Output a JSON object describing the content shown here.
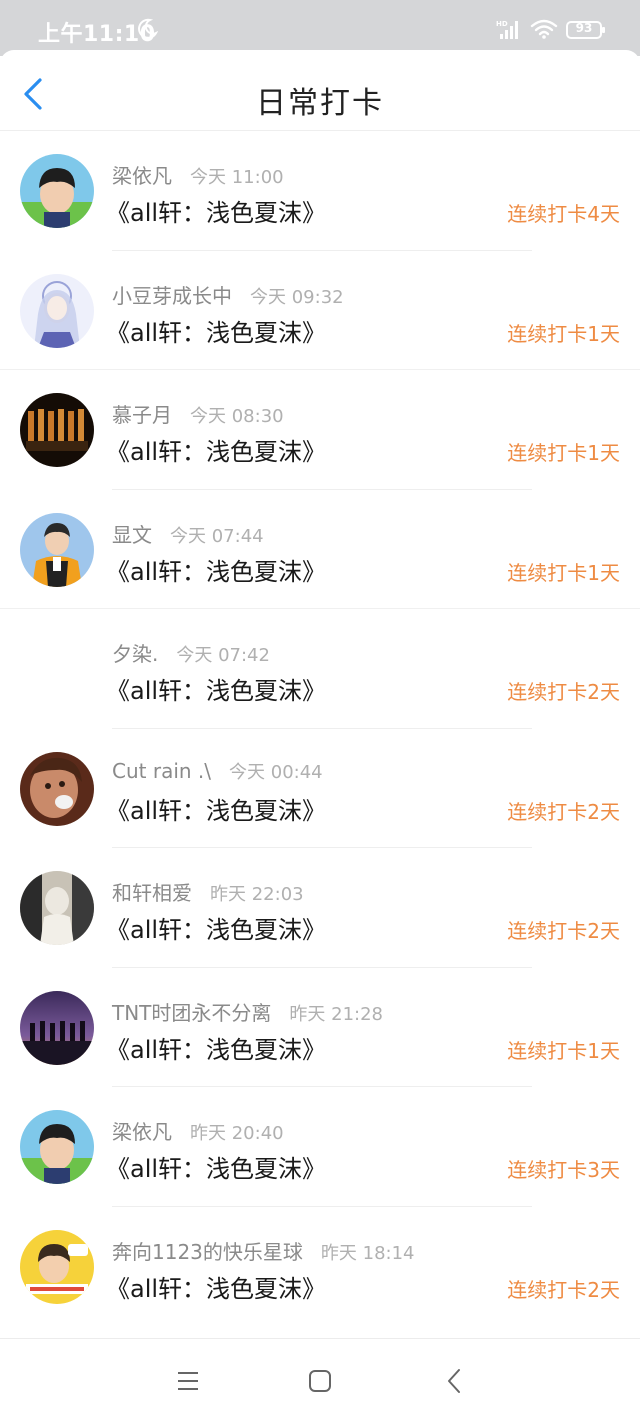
{
  "status_bar": {
    "time": "上午11:10",
    "battery": "93"
  },
  "header": {
    "title": "日常打卡"
  },
  "entries": [
    {
      "name": "梁依凡",
      "time": "今天 11:00",
      "title": "《all轩：浅色夏沫》",
      "streak": "连续打卡4天"
    },
    {
      "name": "小豆芽成长中",
      "time": "今天 09:32",
      "title": "《all轩：浅色夏沫》",
      "streak": "连续打卡1天"
    },
    {
      "name": "慕子月",
      "time": "今天 08:30",
      "title": "《all轩：浅色夏沫》",
      "streak": "连续打卡1天"
    },
    {
      "name": "显文",
      "time": "今天 07:44",
      "title": "《all轩：浅色夏沫》",
      "streak": "连续打卡1天"
    },
    {
      "name": "夕染.",
      "time": "今天 07:42",
      "title": "《all轩：浅色夏沫》",
      "streak": "连续打卡2天"
    },
    {
      "name": "Cut rain .\\",
      "time": "今天 00:44",
      "title": "《all轩：浅色夏沫》",
      "streak": "连续打卡2天"
    },
    {
      "name": "和轩相爱",
      "time": "昨天 22:03",
      "title": "《all轩：浅色夏沫》",
      "streak": "连续打卡2天"
    },
    {
      "name": "TNT时团永不分离",
      "time": "昨天 21:28",
      "title": "《all轩：浅色夏沫》",
      "streak": "连续打卡1天"
    },
    {
      "name": "梁依凡",
      "time": "昨天 20:40",
      "title": "《all轩：浅色夏沫》",
      "streak": "连续打卡3天"
    },
    {
      "name": "奔向1123的快乐星球",
      "time": "昨天 18:14",
      "title": "《all轩：浅色夏沫》",
      "streak": "连续打卡2天"
    }
  ],
  "colors": {
    "accent": "#ee8b43",
    "back_icon": "#2a8ef0",
    "status_bar": "#d5d6d8"
  },
  "icons": {
    "back": "back-arrow-icon",
    "nav_menu": "menu-icon",
    "nav_home": "home-square-icon",
    "nav_back": "back-chevron-icon"
  }
}
